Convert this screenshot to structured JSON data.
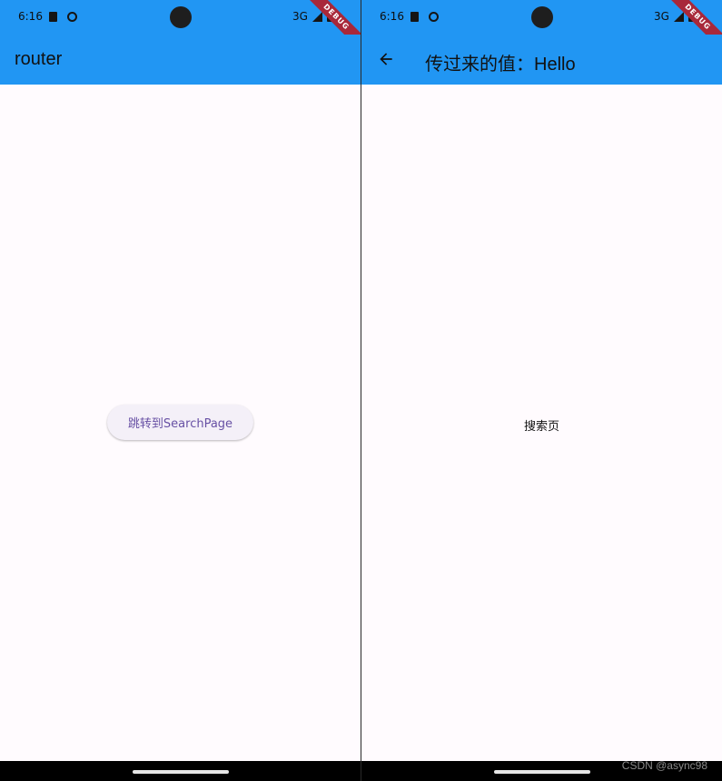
{
  "colors": {
    "appbar": "#2196f3",
    "page_bg": "#fffbfe",
    "button_text": "#6750a4",
    "debug_banner": "#a8283a"
  },
  "left_screen": {
    "status": {
      "time": "6:16",
      "network": "3G",
      "debug": "DEBUG",
      "icons": [
        "sd-card-icon",
        "face-icon",
        "signal-icon",
        "battery-icon"
      ]
    },
    "appbar": {
      "title": "router"
    },
    "body": {
      "button_label": "跳转到SearchPage"
    }
  },
  "right_screen": {
    "status": {
      "time": "6:16",
      "network": "3G",
      "debug": "DEBUG",
      "icons": [
        "sd-card-icon",
        "face-icon",
        "signal-icon",
        "battery-icon"
      ]
    },
    "appbar": {
      "title": "传过来的值：Hello",
      "back_icon": "arrow-left-icon"
    },
    "body": {
      "text": "搜索页"
    }
  },
  "watermark": "CSDN @async98"
}
